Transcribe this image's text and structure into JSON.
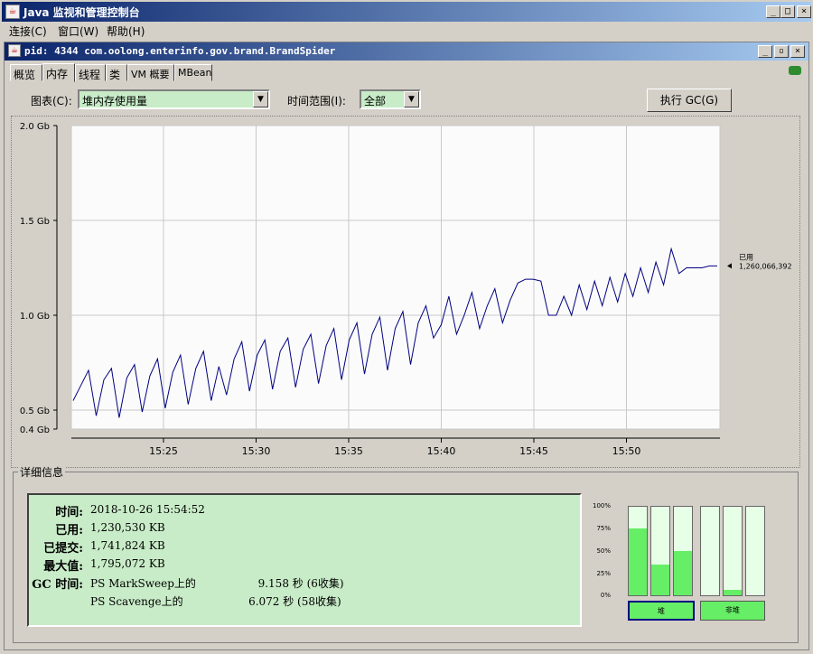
{
  "window": {
    "title": "Java 监视和管理控制台",
    "icon": "java-icon"
  },
  "menu": [
    "连接(C)",
    "窗口(W)",
    "帮助(H)"
  ],
  "inner": {
    "title": "pid: 4344 com.oolong.enterinfo.gov.brand.BrandSpider"
  },
  "tabs": [
    "概览",
    "内存",
    "线程",
    "类",
    "VM 概要",
    "MBean"
  ],
  "active_tab": "内存",
  "controls": {
    "chart_label": "图表(C):",
    "chart_value": "堆内存使用量",
    "range_label": "时间范围(I):",
    "range_value": "全部",
    "gc_button": "执行 GC(G)"
  },
  "chart_data": {
    "type": "line",
    "y_ticks": [
      "2.0 Gb",
      "1.5 Gb",
      "1.0 Gb",
      "0.5 Gb",
      "0.4 Gb"
    ],
    "x_ticks": [
      "15:25",
      "15:30",
      "15:35",
      "15:40",
      "15:45",
      "15:50"
    ],
    "ylim": [
      0.4,
      2.0
    ],
    "series": [
      {
        "name": "已用",
        "color": "#000080",
        "y": [
          0.55,
          0.63,
          0.71,
          0.47,
          0.66,
          0.72,
          0.46,
          0.67,
          0.74,
          0.49,
          0.68,
          0.77,
          0.51,
          0.7,
          0.79,
          0.53,
          0.72,
          0.81,
          0.55,
          0.73,
          0.58,
          0.77,
          0.86,
          0.6,
          0.79,
          0.87,
          0.61,
          0.81,
          0.88,
          0.62,
          0.82,
          0.9,
          0.64,
          0.84,
          0.93,
          0.66,
          0.87,
          0.96,
          0.69,
          0.9,
          0.99,
          0.71,
          0.93,
          1.02,
          0.74,
          0.96,
          1.05,
          0.88,
          0.95,
          1.1,
          0.9,
          1.0,
          1.12,
          0.93,
          1.05,
          1.14,
          0.96,
          1.08,
          1.17,
          1.19,
          1.19,
          1.18,
          1.0,
          1.0,
          1.1,
          1.0,
          1.16,
          1.03,
          1.18,
          1.05,
          1.2,
          1.07,
          1.22,
          1.1,
          1.25,
          1.12,
          1.28,
          1.16,
          1.35,
          1.22,
          1.25,
          1.25,
          1.25,
          1.26,
          1.26
        ]
      }
    ],
    "current_label": "已用",
    "current_value": "1,260,066,392"
  },
  "details": {
    "title": "详细信息",
    "rows": [
      {
        "key": "时间:",
        "value": "2018-10-26 15:54:52"
      },
      {
        "key": "已用:",
        "value": "1,230,530 KB"
      },
      {
        "key": "已提交:",
        "value": "1,741,824 KB"
      },
      {
        "key": "最大值:",
        "value": "1,795,072 KB"
      },
      {
        "key": "GC 时间:",
        "value": "PS MarkSweep上的                  9.158 秒 (6收集)"
      }
    ],
    "gc_second": "PS Scavenge上的                   6.072 秒 (58收集)"
  },
  "bars": {
    "pct_labels": [
      "100%",
      "75%",
      "50%",
      "25%",
      "0%"
    ],
    "heap_fill": [
      0.76,
      0.35,
      0.5
    ],
    "nonheap_fill": [
      0.0,
      0.06,
      0.0
    ],
    "heap_label": "堆",
    "nonheap_label": "非堆",
    "fill_color": "#66ee66"
  }
}
